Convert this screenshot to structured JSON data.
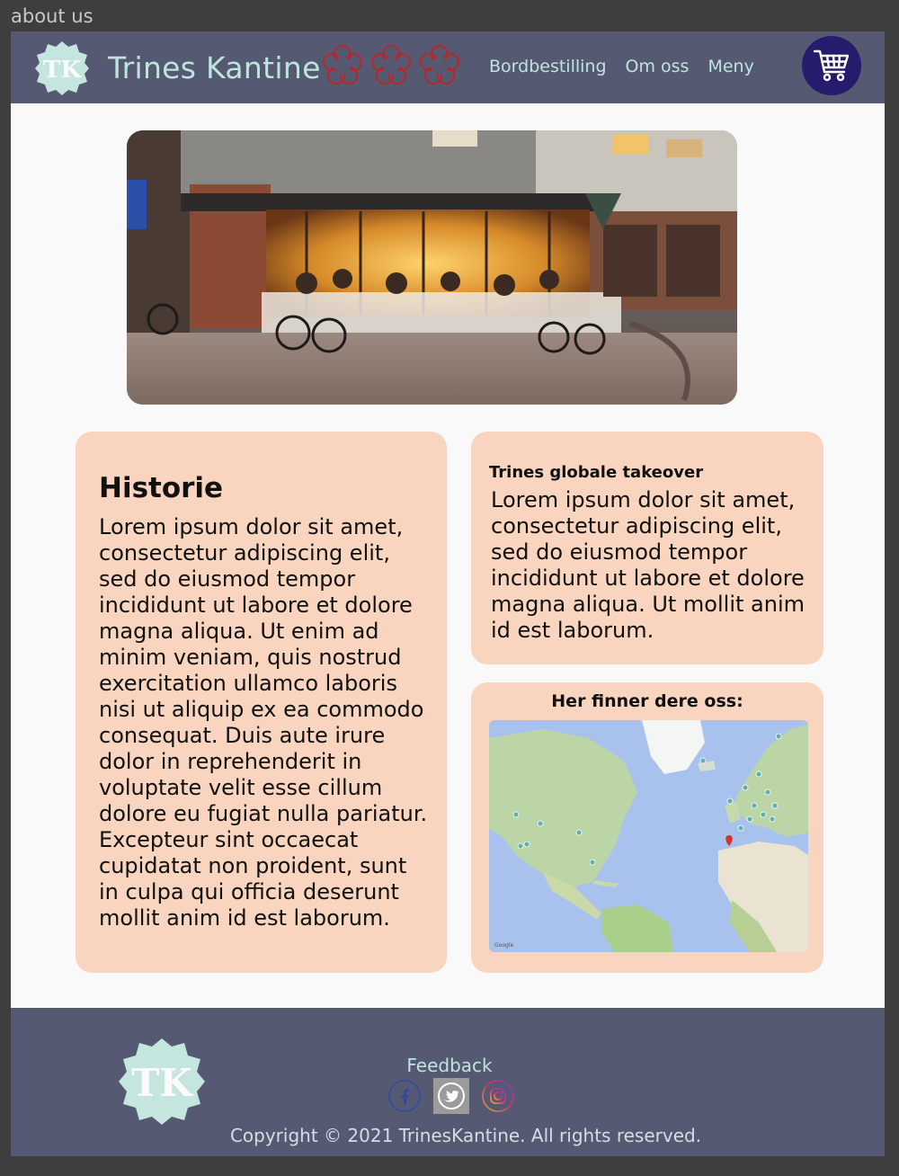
{
  "window": {
    "title": "about us"
  },
  "header": {
    "logo_text": "TK",
    "brand": "Trines Kantine",
    "nav": [
      {
        "label": "Bordbestilling"
      },
      {
        "label": "Om oss"
      },
      {
        "label": "Meny"
      }
    ],
    "cart_icon": "shopping-cart-icon"
  },
  "historie": {
    "title": "Historie",
    "body": "Lorem ipsum dolor sit amet, consectetur adipiscing elit, sed do eiusmod tempor incididunt ut labore et dolore magna aliqua. Ut enim ad minim veniam, quis nostrud exercitation ullamco laboris nisi ut aliquip ex ea commodo consequat. Duis aute irure dolor in reprehenderit in voluptate velit esse cillum dolore eu fugiat nulla pariatur. Excepteur sint occaecat cupidatat non proident, sunt in culpa qui officia deserunt mollit anim id est laborum."
  },
  "takeover": {
    "title": "Trines globale takeover",
    "body": "Lorem ipsum dolor sit amet, consectetur adipiscing elit, sed do eiusmod tempor incididunt ut labore et dolore magna aliqua. Ut mollit anim id est laborum."
  },
  "map": {
    "title": "Her finner dere oss:"
  },
  "footer": {
    "logo_text": "TK",
    "feedback": "Feedback",
    "socials": [
      "facebook-icon",
      "twitter-icon",
      "instagram-icon"
    ],
    "copyright": "Copyright © 2021 TrinesKantine. All rights reserved."
  },
  "colors": {
    "header_bg": "#555a72",
    "accent_mint": "#bfe4de",
    "card_bg": "#f9d5bf",
    "cart_bg": "#261c6e",
    "star_outline": "#b5272b"
  }
}
